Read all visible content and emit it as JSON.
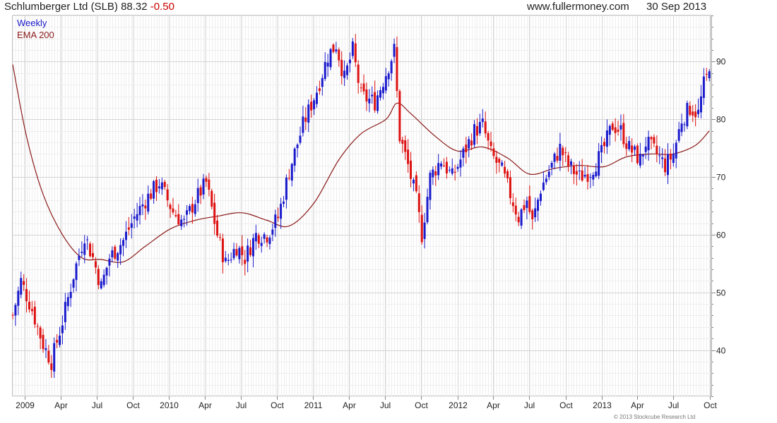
{
  "header": {
    "security": "Schlumberger Ltd (SLB)",
    "last": "88.32",
    "change": "-0.50",
    "source": "www.fullermoney.com",
    "date": "30 Sep 2013"
  },
  "footer": {
    "credit": "© 2013 Stockcube Research Ltd"
  },
  "colors": {
    "up": "#1a1acc",
    "down": "#dd1111",
    "ema": "#8b1a1a",
    "grid": "#d4d4d4",
    "frame": "#888888"
  },
  "chart_data": {
    "type": "candlestick",
    "period_label": "Weekly",
    "legend": [
      "Weekly",
      "EMA 200"
    ],
    "legend_placement": "top-left",
    "y_axis": {
      "position": "right",
      "ylim": [
        32,
        98
      ],
      "ticks": [
        40,
        50,
        60,
        70,
        80,
        90
      ]
    },
    "x_axis": {
      "start": "2008-12-01",
      "end": "2013-10-05",
      "ticks": [
        {
          "label": "2009",
          "date": "2009-01-01"
        },
        {
          "label": "Apr",
          "date": "2009-04-01"
        },
        {
          "label": "Jul",
          "date": "2009-07-01"
        },
        {
          "label": "Oct",
          "date": "2009-10-01"
        },
        {
          "label": "2010",
          "date": "2010-01-01"
        },
        {
          "label": "Apr",
          "date": "2010-04-01"
        },
        {
          "label": "Jul",
          "date": "2010-07-01"
        },
        {
          "label": "Oct",
          "date": "2010-10-01"
        },
        {
          "label": "2011",
          "date": "2011-01-01"
        },
        {
          "label": "Apr",
          "date": "2011-04-01"
        },
        {
          "label": "Jul",
          "date": "2011-07-01"
        },
        {
          "label": "Oct",
          "date": "2011-10-01"
        },
        {
          "label": "2012",
          "date": "2012-01-01"
        },
        {
          "label": "Apr",
          "date": "2012-04-01"
        },
        {
          "label": "Jul",
          "date": "2012-07-01"
        },
        {
          "label": "Oct",
          "date": "2012-10-01"
        },
        {
          "label": "2013",
          "date": "2013-01-01"
        },
        {
          "label": "Apr",
          "date": "2013-04-01"
        },
        {
          "label": "Jul",
          "date": "2013-07-01"
        },
        {
          "label": "Oct",
          "date": "2013-10-01"
        }
      ]
    },
    "grid": true,
    "anchor_closes": [
      {
        "d": "2008-12-01",
        "v": 46
      },
      {
        "d": "2008-12-22",
        "v": 52
      },
      {
        "d": "2009-01-19",
        "v": 47
      },
      {
        "d": "2009-02-16",
        "v": 41
      },
      {
        "d": "2009-03-09",
        "v": 38
      },
      {
        "d": "2009-04-06",
        "v": 45
      },
      {
        "d": "2009-05-04",
        "v": 53
      },
      {
        "d": "2009-06-01",
        "v": 60
      },
      {
        "d": "2009-06-22",
        "v": 56
      },
      {
        "d": "2009-07-13",
        "v": 51
      },
      {
        "d": "2009-08-03",
        "v": 56
      },
      {
        "d": "2009-09-07",
        "v": 59
      },
      {
        "d": "2009-10-05",
        "v": 63
      },
      {
        "d": "2009-11-02",
        "v": 66
      },
      {
        "d": "2009-12-07",
        "v": 69
      },
      {
        "d": "2010-01-11",
        "v": 64
      },
      {
        "d": "2010-02-08",
        "v": 62
      },
      {
        "d": "2010-03-08",
        "v": 66
      },
      {
        "d": "2010-04-05",
        "v": 69
      },
      {
        "d": "2010-05-03",
        "v": 60
      },
      {
        "d": "2010-05-24",
        "v": 55
      },
      {
        "d": "2010-06-21",
        "v": 58
      },
      {
        "d": "2010-07-12",
        "v": 56
      },
      {
        "d": "2010-08-09",
        "v": 60
      },
      {
        "d": "2010-09-06",
        "v": 60
      },
      {
        "d": "2010-10-04",
        "v": 63
      },
      {
        "d": "2010-11-01",
        "v": 71
      },
      {
        "d": "2010-12-06",
        "v": 79
      },
      {
        "d": "2011-01-10",
        "v": 85
      },
      {
        "d": "2011-02-07",
        "v": 91
      },
      {
        "d": "2011-02-28",
        "v": 93
      },
      {
        "d": "2011-03-21",
        "v": 87
      },
      {
        "d": "2011-04-11",
        "v": 92
      },
      {
        "d": "2011-05-02",
        "v": 84
      },
      {
        "d": "2011-06-06",
        "v": 83
      },
      {
        "d": "2011-07-04",
        "v": 88
      },
      {
        "d": "2011-07-25",
        "v": 92
      },
      {
        "d": "2011-08-08",
        "v": 77
      },
      {
        "d": "2011-08-29",
        "v": 72
      },
      {
        "d": "2011-09-19",
        "v": 66
      },
      {
        "d": "2011-10-03",
        "v": 60
      },
      {
        "d": "2011-10-24",
        "v": 70
      },
      {
        "d": "2011-11-21",
        "v": 73
      },
      {
        "d": "2011-12-19",
        "v": 70
      },
      {
        "d": "2012-01-16",
        "v": 74
      },
      {
        "d": "2012-02-13",
        "v": 78
      },
      {
        "d": "2012-03-05",
        "v": 79
      },
      {
        "d": "2012-03-26",
        "v": 74
      },
      {
        "d": "2012-04-23",
        "v": 71
      },
      {
        "d": "2012-05-14",
        "v": 67
      },
      {
        "d": "2012-06-04",
        "v": 63
      },
      {
        "d": "2012-06-25",
        "v": 66
      },
      {
        "d": "2012-07-09",
        "v": 62
      },
      {
        "d": "2012-07-30",
        "v": 68
      },
      {
        "d": "2012-08-27",
        "v": 72
      },
      {
        "d": "2012-09-17",
        "v": 75
      },
      {
        "d": "2012-10-08",
        "v": 72
      },
      {
        "d": "2012-11-05",
        "v": 70
      },
      {
        "d": "2012-12-03",
        "v": 71
      },
      {
        "d": "2012-12-31",
        "v": 74
      },
      {
        "d": "2013-01-28",
        "v": 79
      },
      {
        "d": "2013-02-18",
        "v": 78
      },
      {
        "d": "2013-03-11",
        "v": 75
      },
      {
        "d": "2013-04-08",
        "v": 73
      },
      {
        "d": "2013-04-22",
        "v": 76
      },
      {
        "d": "2013-05-20",
        "v": 74
      },
      {
        "d": "2013-06-10",
        "v": 72
      },
      {
        "d": "2013-07-01",
        "v": 74
      },
      {
        "d": "2013-07-22",
        "v": 80
      },
      {
        "d": "2013-08-12",
        "v": 82
      },
      {
        "d": "2013-09-02",
        "v": 81
      },
      {
        "d": "2013-09-16",
        "v": 86
      },
      {
        "d": "2013-09-30",
        "v": 88.32
      }
    ],
    "ema200": [
      {
        "d": "2008-12-01",
        "v": 89.5
      },
      {
        "d": "2009-01-05",
        "v": 77
      },
      {
        "d": "2009-02-16",
        "v": 67
      },
      {
        "d": "2009-04-06",
        "v": 60
      },
      {
        "d": "2009-05-25",
        "v": 56
      },
      {
        "d": "2009-07-13",
        "v": 55.7
      },
      {
        "d": "2009-09-07",
        "v": 55.3
      },
      {
        "d": "2009-11-02",
        "v": 58
      },
      {
        "d": "2010-01-04",
        "v": 61
      },
      {
        "d": "2010-03-08",
        "v": 62.5
      },
      {
        "d": "2010-05-03",
        "v": 63.2
      },
      {
        "d": "2010-07-05",
        "v": 63.8
      },
      {
        "d": "2010-09-06",
        "v": 62.5
      },
      {
        "d": "2010-11-01",
        "v": 61.5
      },
      {
        "d": "2011-01-03",
        "v": 65.5
      },
      {
        "d": "2011-03-07",
        "v": 73
      },
      {
        "d": "2011-05-02",
        "v": 77.5
      },
      {
        "d": "2011-07-04",
        "v": 80
      },
      {
        "d": "2011-08-01",
        "v": 82.8
      },
      {
        "d": "2011-09-05",
        "v": 81
      },
      {
        "d": "2011-11-07",
        "v": 77
      },
      {
        "d": "2012-01-02",
        "v": 74.5
      },
      {
        "d": "2012-03-05",
        "v": 75.2
      },
      {
        "d": "2012-05-07",
        "v": 73.3
      },
      {
        "d": "2012-07-02",
        "v": 70.5
      },
      {
        "d": "2012-09-03",
        "v": 71.5
      },
      {
        "d": "2012-11-05",
        "v": 72
      },
      {
        "d": "2013-01-07",
        "v": 71.8
      },
      {
        "d": "2013-03-04",
        "v": 73.5
      },
      {
        "d": "2013-05-06",
        "v": 74
      },
      {
        "d": "2013-07-01",
        "v": 74
      },
      {
        "d": "2013-08-26",
        "v": 75.5
      },
      {
        "d": "2013-09-30",
        "v": 78
      }
    ]
  }
}
